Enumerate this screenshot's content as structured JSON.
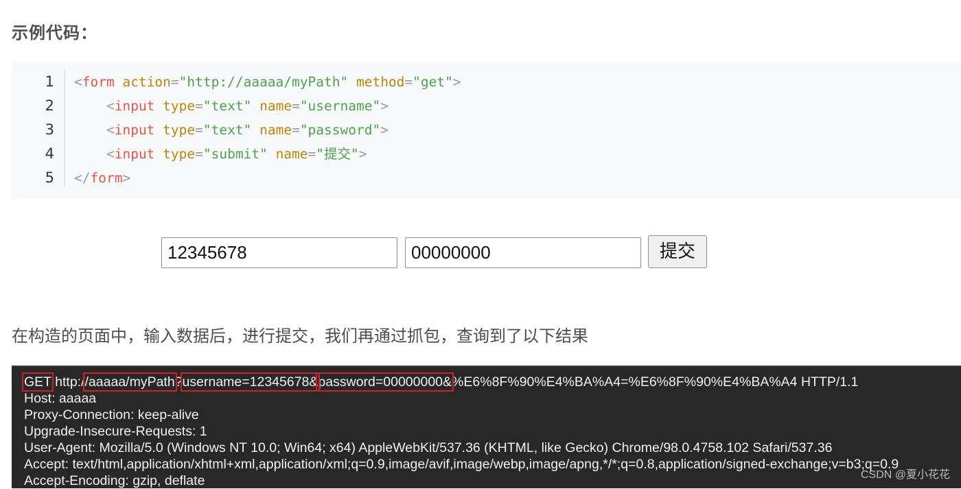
{
  "heading": "示例代码：",
  "code": {
    "line_numbers": [
      "1",
      "2",
      "3",
      "4",
      "5"
    ],
    "lines": [
      [
        {
          "t": "punc",
          "v": "<"
        },
        {
          "t": "tag",
          "v": "form"
        },
        {
          "t": "plain",
          "v": " "
        },
        {
          "t": "attr",
          "v": "action"
        },
        {
          "t": "eq",
          "v": "="
        },
        {
          "t": "str",
          "v": "\"http://aaaaa/myPath\""
        },
        {
          "t": "plain",
          "v": " "
        },
        {
          "t": "attr",
          "v": "method"
        },
        {
          "t": "eq",
          "v": "="
        },
        {
          "t": "str",
          "v": "\"get\""
        },
        {
          "t": "punc",
          "v": ">"
        }
      ],
      [
        {
          "t": "plain",
          "v": "    "
        },
        {
          "t": "punc",
          "v": "<"
        },
        {
          "t": "tag",
          "v": "input"
        },
        {
          "t": "plain",
          "v": " "
        },
        {
          "t": "attr",
          "v": "type"
        },
        {
          "t": "eq",
          "v": "="
        },
        {
          "t": "str",
          "v": "\"text\""
        },
        {
          "t": "plain",
          "v": " "
        },
        {
          "t": "attr",
          "v": "name"
        },
        {
          "t": "eq",
          "v": "="
        },
        {
          "t": "str",
          "v": "\"username\""
        },
        {
          "t": "punc",
          "v": ">"
        }
      ],
      [
        {
          "t": "plain",
          "v": "    "
        },
        {
          "t": "punc",
          "v": "<"
        },
        {
          "t": "tag",
          "v": "input"
        },
        {
          "t": "plain",
          "v": " "
        },
        {
          "t": "attr",
          "v": "type"
        },
        {
          "t": "eq",
          "v": "="
        },
        {
          "t": "str",
          "v": "\"text\""
        },
        {
          "t": "plain",
          "v": " "
        },
        {
          "t": "attr",
          "v": "name"
        },
        {
          "t": "eq",
          "v": "="
        },
        {
          "t": "str",
          "v": "\"password\""
        },
        {
          "t": "punc",
          "v": ">"
        }
      ],
      [
        {
          "t": "plain",
          "v": "    "
        },
        {
          "t": "punc",
          "v": "<"
        },
        {
          "t": "tag",
          "v": "input"
        },
        {
          "t": "plain",
          "v": " "
        },
        {
          "t": "attr",
          "v": "type"
        },
        {
          "t": "eq",
          "v": "="
        },
        {
          "t": "str",
          "v": "\"submit\""
        },
        {
          "t": "plain",
          "v": " "
        },
        {
          "t": "attr",
          "v": "name"
        },
        {
          "t": "eq",
          "v": "="
        },
        {
          "t": "str",
          "v": "\"提交\""
        },
        {
          "t": "punc",
          "v": ">"
        }
      ],
      [
        {
          "t": "punc",
          "v": "</"
        },
        {
          "t": "tag",
          "v": "form"
        },
        {
          "t": "punc",
          "v": ">"
        }
      ]
    ]
  },
  "demo_form": {
    "username_value": "12345678",
    "password_value": "00000000",
    "submit_label": "提交"
  },
  "paragraph": "在构造的页面中，输入数据后，进行提交，我们再通过抓包，查询到了以下结果",
  "capture": {
    "request_line": [
      {
        "v": "GET",
        "hl": true
      },
      {
        "v": " http:/",
        "hl": false
      },
      {
        "v": "/aaaaa/myPath",
        "hl": true
      },
      {
        "v": "?",
        "hl": false
      },
      {
        "v": "username=12345678&",
        "hl": true
      },
      {
        "v": "password=00000000&",
        "hl": true
      },
      {
        "v": "%E6%8F%90%E4%BA%A4=%E6%8F%90%E4%BA%A4 HTTP/1.1",
        "hl": false
      }
    ],
    "headers": [
      "Host: aaaaa",
      "Proxy-Connection: keep-alive",
      "Upgrade-Insecure-Requests: 1",
      "User-Agent: Mozilla/5.0 (Windows NT 10.0; Win64; x64) AppleWebKit/537.36 (KHTML, like Gecko) Chrome/98.0.4758.102 Safari/537.36",
      "Accept: text/html,application/xhtml+xml,application/xml;q=0.9,image/avif,image/webp,image/apng,*/*;q=0.8,application/signed-exchange;v=b3;q=0.9",
      "Accept-Encoding: gzip, deflate"
    ],
    "highlight_color": "#d0212b"
  },
  "watermark": "CSDN @夏小花花"
}
